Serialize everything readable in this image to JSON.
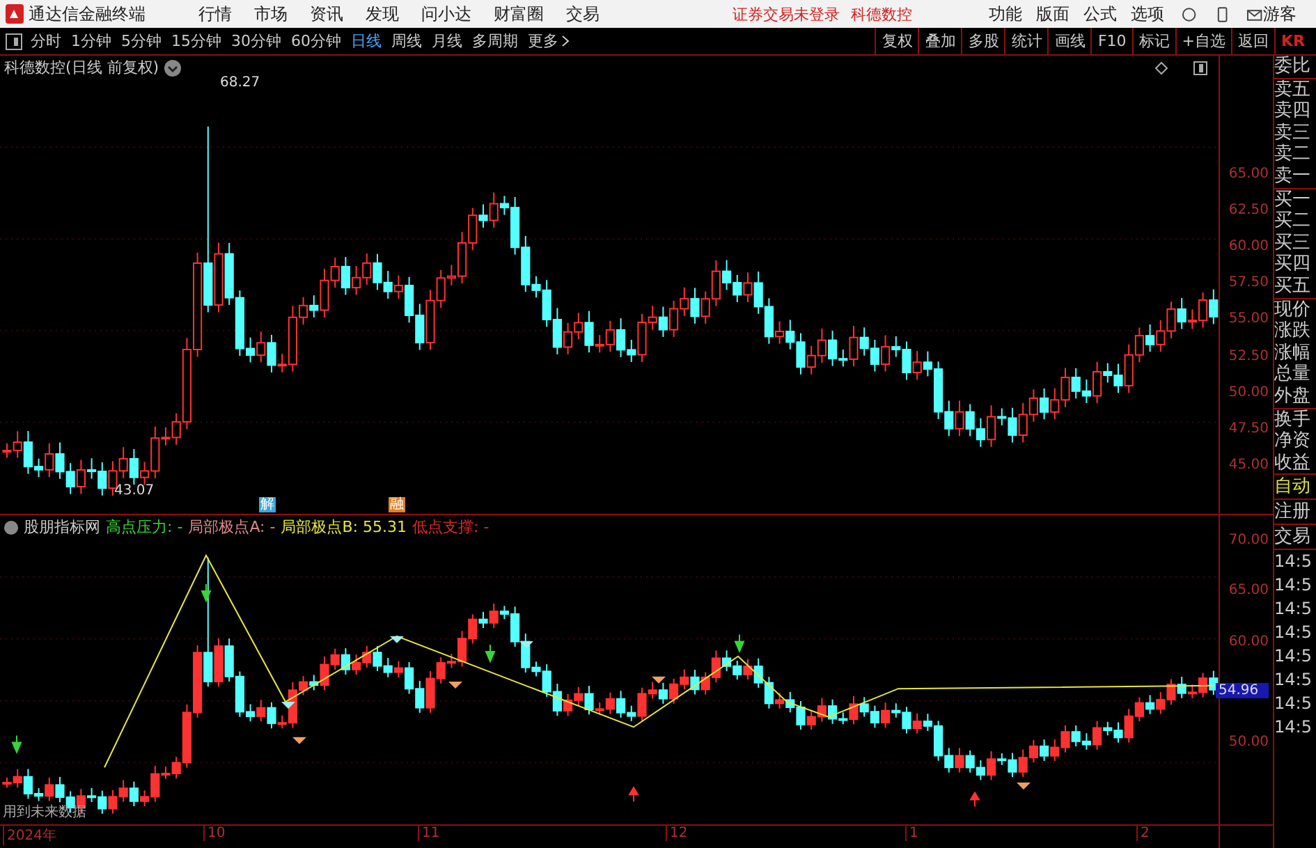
{
  "menu_bar": {
    "app_title": "通达信金融终端",
    "menus": [
      "行情",
      "市场",
      "资讯",
      "发现",
      "问小达",
      "财富圈",
      "交易"
    ],
    "notices": [
      "证券交易未登录",
      "科德数控"
    ],
    "tools": [
      "功能",
      "版面",
      "公式",
      "选项"
    ],
    "guest": "游客"
  },
  "toolbar": {
    "periods": [
      {
        "label": "分时",
        "selected": false
      },
      {
        "label": "1分钟",
        "selected": false
      },
      {
        "label": "5分钟",
        "selected": false
      },
      {
        "label": "15分钟",
        "selected": false
      },
      {
        "label": "30分钟",
        "selected": false
      },
      {
        "label": "60分钟",
        "selected": false
      },
      {
        "label": "日线",
        "selected": true
      },
      {
        "label": "周线",
        "selected": false
      },
      {
        "label": "月线",
        "selected": false
      },
      {
        "label": "多周期",
        "selected": false
      }
    ],
    "more": "更多",
    "actions": [
      "复权",
      "叠加",
      "多股",
      "统计",
      "画线",
      "F10",
      "标记",
      "+自选",
      "返回"
    ],
    "edge_text": "KR"
  },
  "price_chart": {
    "title": "科德数控(日线 前复权)",
    "high_label": "68.27",
    "low_label": "43.07",
    "event_tags": [
      {
        "label": "解",
        "color": "#3aa8d8"
      },
      {
        "label": "融",
        "color": "#e08020"
      }
    ],
    "yticks": [
      "65.00",
      "62.50",
      "60.00",
      "57.50",
      "55.00",
      "52.50",
      "50.00",
      "47.50",
      "45.00"
    ]
  },
  "indicator": {
    "name": "股朋指标网",
    "legend": [
      {
        "label": "高点压力:",
        "value": "-",
        "color": "#39d439"
      },
      {
        "label": "局部极点A:",
        "value": "-",
        "color": "#e08a8a"
      },
      {
        "label": "局部极点B:",
        "value": "55.31",
        "color": "#e6e640"
      },
      {
        "label": "低点支撑:",
        "value": "-",
        "color": "#e02828"
      }
    ],
    "yticks": [
      "70.00",
      "65.00",
      "60.00",
      "50.00"
    ],
    "price_tag": "54.96",
    "note": "用到未来数据"
  },
  "date_axis": [
    "2024年",
    "10",
    "11",
    "12",
    "1",
    "2"
  ],
  "side_panel": {
    "groups": [
      [
        "委比"
      ],
      [
        "卖五",
        "卖四",
        "卖三",
        "卖二",
        "卖一"
      ],
      [
        "买一",
        "买二",
        "买三",
        "买四",
        "买五"
      ],
      [
        "现价",
        "涨跌",
        "涨幅",
        "总量",
        "外盘"
      ],
      [
        "换手",
        "净资",
        "收益"
      ]
    ],
    "links": [
      {
        "label": "自动",
        "selected": true
      },
      {
        "label": "注册",
        "selected": false
      },
      {
        "label": "交易",
        "selected": false
      }
    ],
    "times": [
      "14:5",
      "14:5",
      "14:5",
      "14:5",
      "14:5",
      "14:5",
      "14:5",
      "14:5"
    ]
  }
}
